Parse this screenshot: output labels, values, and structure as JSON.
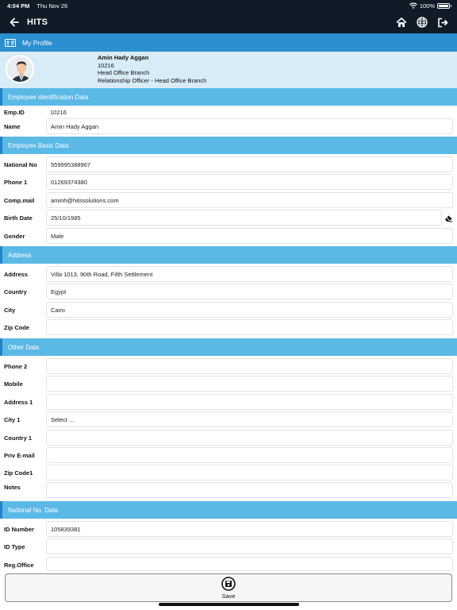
{
  "status_bar": {
    "time": "4:04 PM",
    "date": "Thu Nov 26",
    "battery": "100%"
  },
  "nav": {
    "title": "HITS",
    "icons": [
      "arrow-left-icon",
      "home-icon",
      "globe-icon",
      "logout-icon"
    ]
  },
  "profile_header": {
    "title": "My Profile"
  },
  "profile": {
    "name": "Amin Hady Aggan",
    "id": "10216",
    "branch": "Head Office Branch",
    "position": "Relationship Officer - Head Office Branch"
  },
  "sections": {
    "employee_identification": "Employee identification Data",
    "employee_basic": "Employee Basic Data",
    "address": "Address",
    "other": "Other Data",
    "national": "National No. Data"
  },
  "fields": {
    "emp_id": {
      "label": "Emp.ID",
      "value": "10216"
    },
    "name": {
      "label": "Name",
      "value": "Amin Hady Aggan"
    },
    "national_no": {
      "label": "National No",
      "value": "559995388967"
    },
    "phone1": {
      "label": "Phone 1",
      "value": "01269374380"
    },
    "comp_mail": {
      "label": "Comp.mail",
      "value": "aminh@hitssolutions.com"
    },
    "birth_date": {
      "label": "Birth Date",
      "value": "25/10/1985"
    },
    "gender": {
      "label": "Gender",
      "value": "Male"
    },
    "address": {
      "label": "Address",
      "value": "Villa 1013, 90th Road, Fifth Settlement"
    },
    "country": {
      "label": "Country",
      "value": "Egypt"
    },
    "city": {
      "label": "City",
      "value": "Cairo"
    },
    "zip_code": {
      "label": "Zip Code",
      "value": ""
    },
    "phone2": {
      "label": "Phone 2",
      "value": ""
    },
    "mobile": {
      "label": "Mobile",
      "value": ""
    },
    "address1": {
      "label": "Address 1",
      "value": ""
    },
    "city1": {
      "label": "City 1",
      "value": "Select ..."
    },
    "country1": {
      "label": "Country 1",
      "value": ""
    },
    "priv_email": {
      "label": "Priv E-mail",
      "value": ""
    },
    "zip_code1": {
      "label": "Zip Code1",
      "value": ""
    },
    "notes": {
      "label": "Notes",
      "value": ""
    },
    "id_number": {
      "label": "ID Number",
      "value": "105839381"
    },
    "id_type": {
      "label": "ID Type",
      "value": ""
    },
    "reg_office": {
      "label": "Reg.Office",
      "value": ""
    }
  },
  "save": {
    "label": "Save"
  },
  "colors": {
    "nav_bg": "#0f1b26",
    "header_blue": "#2b8fd0",
    "section_blue": "#5bb9e6",
    "profile_bg": "#d7ecf7"
  }
}
